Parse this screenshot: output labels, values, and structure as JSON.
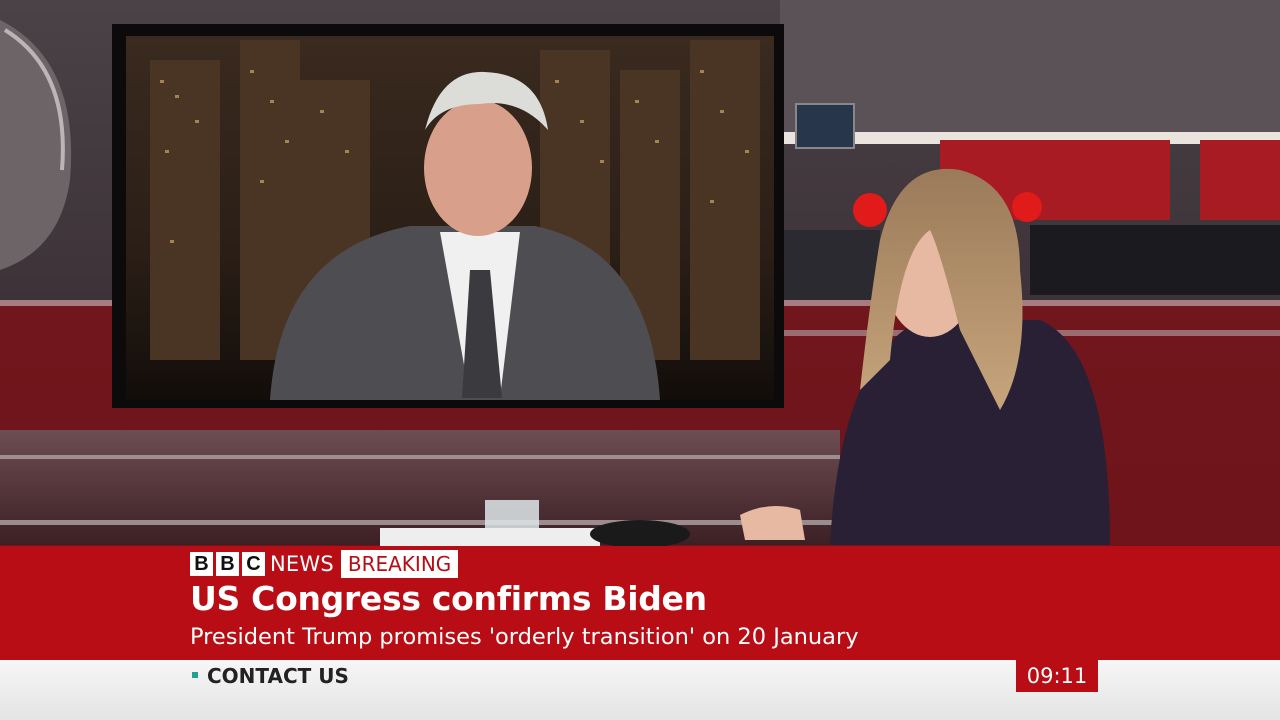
{
  "broadcast": {
    "logo_letters": [
      "B",
      "B",
      "C"
    ],
    "logo_word": "NEWS",
    "badge": "BREAKING",
    "headline": "US Congress confirms Biden",
    "subheadline": "President Trump promises 'orderly transition' on 20 January",
    "ticker": "CONTACT US",
    "clock": "09:11"
  },
  "colors": {
    "brand_red": "#b80d14",
    "ticker_bg": "#f0f0f0",
    "ticker_dot": "#1fa38a"
  }
}
